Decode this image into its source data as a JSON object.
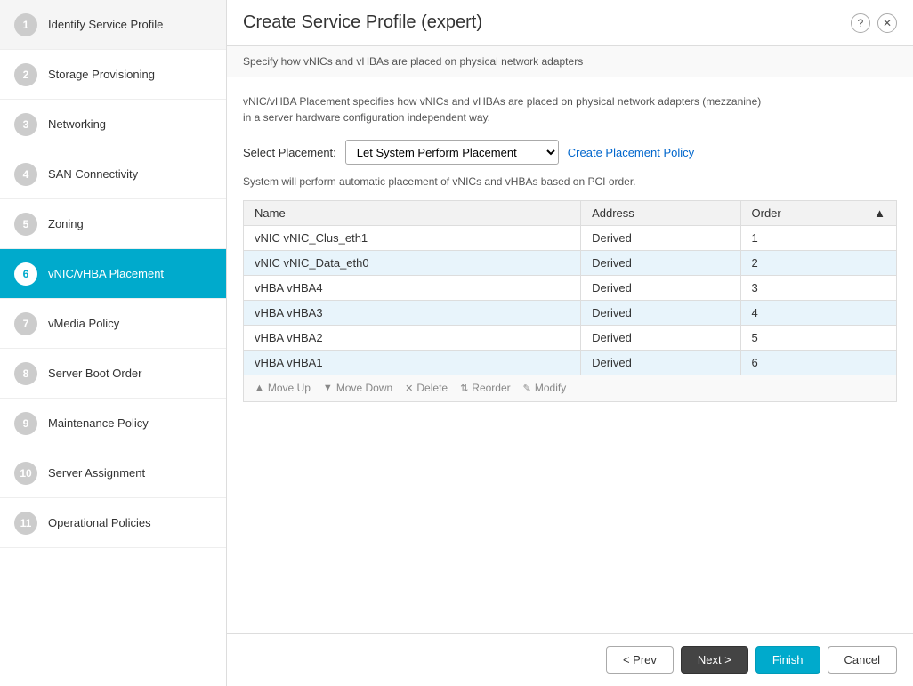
{
  "dialog": {
    "title": "Create Service Profile (expert)",
    "help_icon": "?",
    "close_icon": "✕"
  },
  "info_bar": {
    "text": "Specify how vNICs and vHBAs are placed on physical network adapters"
  },
  "content": {
    "description_line1": "vNIC/vHBA Placement specifies how vNICs and vHBAs are placed on physical network adapters (mezzanine)",
    "description_line2": "in a server hardware configuration independent way.",
    "select_placement_label": "Select Placement:",
    "select_placement_value": "Let System Perform Placement",
    "create_policy_link": "Create Placement Policy",
    "auto_placement_text": "System will perform automatic placement of vNICs and vHBAs based on PCI order.",
    "table": {
      "columns": [
        "Name",
        "Address",
        "Order"
      ],
      "rows": [
        {
          "name": "vNIC vNIC_Clus_eth1",
          "address": "Derived",
          "order": "1"
        },
        {
          "name": "vNIC vNIC_Data_eth0",
          "address": "Derived",
          "order": "2"
        },
        {
          "name": "vHBA vHBA4",
          "address": "Derived",
          "order": "3"
        },
        {
          "name": "vHBA vHBA3",
          "address": "Derived",
          "order": "4"
        },
        {
          "name": "vHBA vHBA2",
          "address": "Derived",
          "order": "5"
        },
        {
          "name": "vHBA vHBA1",
          "address": "Derived",
          "order": "6"
        }
      ]
    },
    "toolbar": {
      "move_up": "Move Up",
      "move_down": "Move Down",
      "delete": "Delete",
      "reorder": "Reorder",
      "modify": "Modify"
    }
  },
  "sidebar": {
    "items": [
      {
        "num": "1",
        "label": "Identify Service Profile"
      },
      {
        "num": "2",
        "label": "Storage Provisioning"
      },
      {
        "num": "3",
        "label": "Networking"
      },
      {
        "num": "4",
        "label": "SAN Connectivity"
      },
      {
        "num": "5",
        "label": "Zoning"
      },
      {
        "num": "6",
        "label": "vNIC/vHBA Placement",
        "active": true
      },
      {
        "num": "7",
        "label": "vMedia Policy"
      },
      {
        "num": "8",
        "label": "Server Boot Order"
      },
      {
        "num": "9",
        "label": "Maintenance Policy"
      },
      {
        "num": "10",
        "label": "Server Assignment"
      },
      {
        "num": "11",
        "label": "Operational Policies"
      }
    ]
  },
  "footer": {
    "prev_label": "< Prev",
    "next_label": "Next >",
    "finish_label": "Finish",
    "cancel_label": "Cancel"
  }
}
